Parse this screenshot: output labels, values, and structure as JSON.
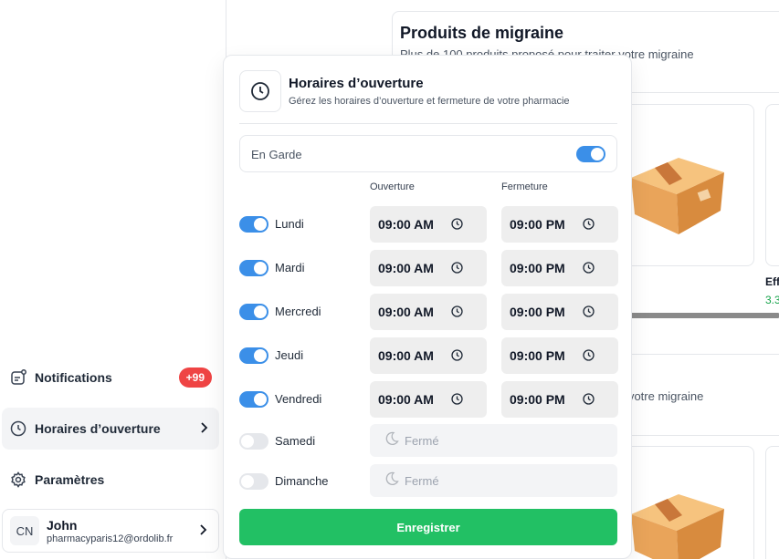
{
  "sidebar": {
    "items": [
      {
        "label": "Notifications",
        "badge": "+99"
      },
      {
        "label": "Horaires d’ouverture"
      },
      {
        "label": "Paramètres"
      }
    ],
    "user": {
      "initials": "CN",
      "name": "John",
      "email": "pharmacyparis12@ordolib.fr"
    }
  },
  "background": {
    "title": "Produits de migraine",
    "subtitle": "Plus de 100 produits proposé pour traiter votre migraine",
    "subtitle_partial": "r votre migraine",
    "product_name_partial": "Eff",
    "product_value_partial": "3.3"
  },
  "popover": {
    "title": "Horaires d’ouverture",
    "subtitle": "Gérez les horaires d’ouverture et fermeture de votre pharmacie",
    "garde_label": "En Garde",
    "garde_on": true,
    "col_open": "Ouverture",
    "col_close": "Fermeture",
    "days": [
      {
        "label": "Lundi",
        "on": true,
        "open": "09:00 AM",
        "close": "09:00 PM"
      },
      {
        "label": "Mardi",
        "on": true,
        "open": "09:00 AM",
        "close": "09:00 PM"
      },
      {
        "label": "Mercredi",
        "on": true,
        "open": "09:00 AM",
        "close": "09:00 PM"
      },
      {
        "label": "Jeudi",
        "on": true,
        "open": "09:00 AM",
        "close": "09:00 PM"
      },
      {
        "label": "Vendredi",
        "on": true,
        "open": "09:00 AM",
        "close": "09:00 PM"
      },
      {
        "label": "Samedi",
        "on": false,
        "closed_label": "Fermé"
      },
      {
        "label": "Dimanche",
        "on": false,
        "closed_label": "Fermé"
      }
    ],
    "save_label": "Enregistrer"
  },
  "colors": {
    "accent": "#3b8fe8",
    "save": "#22c064",
    "badge": "#ef4444"
  }
}
